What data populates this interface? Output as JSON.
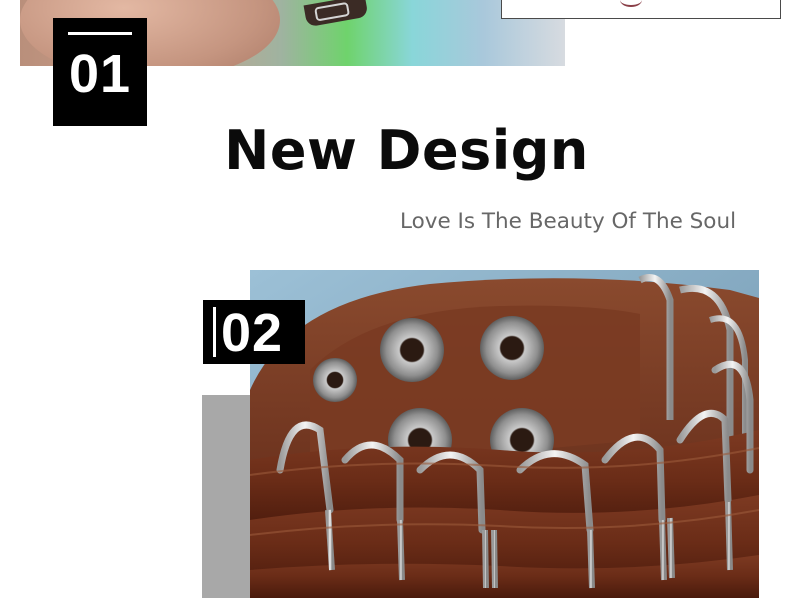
{
  "section_one": {
    "number": "01"
  },
  "headline": "New Design",
  "tagline": "Love Is The Beauty Of The Soul",
  "section_two": {
    "number": "02"
  },
  "colors": {
    "badge_background": "#000000",
    "badge_text": "#ffffff",
    "headline": "#0b0b0b",
    "tagline": "#676767",
    "accent_block": "#a8a8a8",
    "leather": "#6b2e1a"
  },
  "images": {
    "top_photo": "wrist-with-bracelet-photo",
    "product_photo": "brown-leather-cuff-bracelet-photo"
  }
}
